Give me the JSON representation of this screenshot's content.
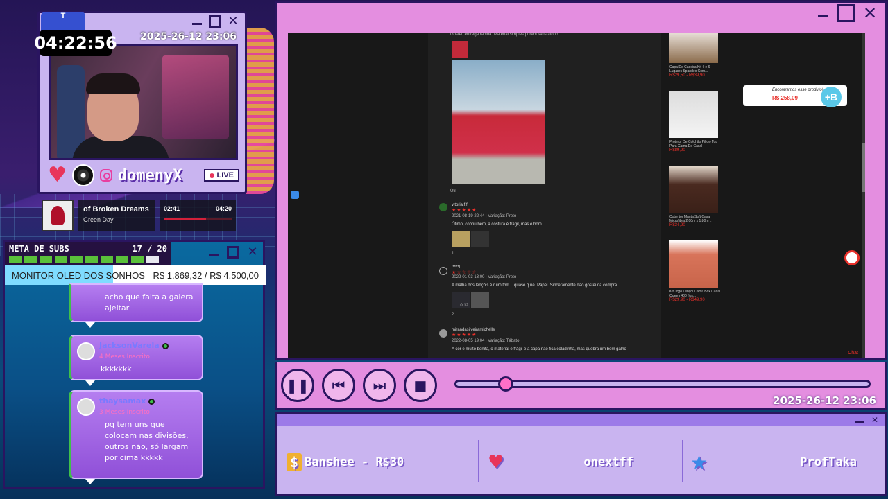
{
  "cam": {
    "tab_label": "T",
    "clock": "04:22:56",
    "date": "2025-26-12 23:06",
    "name": "domenyX",
    "live": "LIVE"
  },
  "music": {
    "title": "of Broken Dreams",
    "artist": "Green Day",
    "elapsed": "02:41",
    "total": "04:20",
    "progress": 0.62
  },
  "subs": {
    "label": "META DE SUBS",
    "count": "17 / 20",
    "filled": 17,
    "total": 20
  },
  "goal": {
    "title": "MONITOR OLED DOS SONHOS",
    "amount": "R$ 1.869,32 / R$ 4.500,00",
    "progress": 0.415
  },
  "chat": {
    "messages": [
      {
        "text": "acho que falta a galera ajeitar"
      },
      {
        "user": "JacksonVarela",
        "months": "4 Meses Inscrito",
        "text": "kkkkkkk"
      },
      {
        "user": "thaysamax",
        "months": "3 Meses Inscrito",
        "text": "pq tem uns que colocam nas divisões, outros não, só largam por cima kkkkk"
      }
    ]
  },
  "page": {
    "top_review": "Gostei, entrega rápida. Material simples porém satisfatório.",
    "likes1": "Útil",
    "r2": {
      "user": "vitoria.f.f",
      "meta": "2021-08-19 22:44 | Variação: Preto",
      "text": "Ótimo, cobriu bem, a costura é frágil, mas é bom",
      "likes": "1"
    },
    "r3": {
      "user": "l****l",
      "meta": "2022-01-03 13:00 | Variação: Preto",
      "text": "A malha dos lençóis é ruim tbm... quase q ne. Papel. Sinceramente nao gostei da compra.",
      "likes": "2",
      "video_time": "0:12"
    },
    "r4": {
      "user": "mirandasilveiramichelle",
      "meta": "2022-08-05 19:04 | Variação: Tábato",
      "text": "A cor e muito bonita, o material é frágil e a capa nao fica coladinha, mas quebra um bom galho"
    },
    "products": [
      {
        "title": "Capa De Cadeira Kit 4 e 6 Lugares Spandex Com...",
        "price": "R$29,50 - R$39,90"
      },
      {
        "title": "Protetor De Colchão Pillow Top Para Cama De Casal",
        "price": "R$89,90"
      },
      {
        "title": "Cobertor Manta Soft Casal Microfibra 2,00m x 1,80m ...",
        "price": "R$34,90"
      },
      {
        "title": "Kit Jogo Lençol Cama Box Casal Queen 400 fios...",
        "price": "R$29,90 - R$49,90"
      }
    ],
    "popup_title": "Encontramos esse produto!",
    "popup_price": "R$ 258,09",
    "chat_link": "Chat"
  },
  "player": {
    "date": "2025-26-12 23:06",
    "progress": 0.12
  },
  "alerts": {
    "donation": "Banshee - R$30",
    "follower": "onextff",
    "subscriber": "ProfTaka"
  },
  "colors": {
    "accent": "#e48ee0",
    "frame": "#2a1560",
    "panel": "#c9b4f0"
  }
}
